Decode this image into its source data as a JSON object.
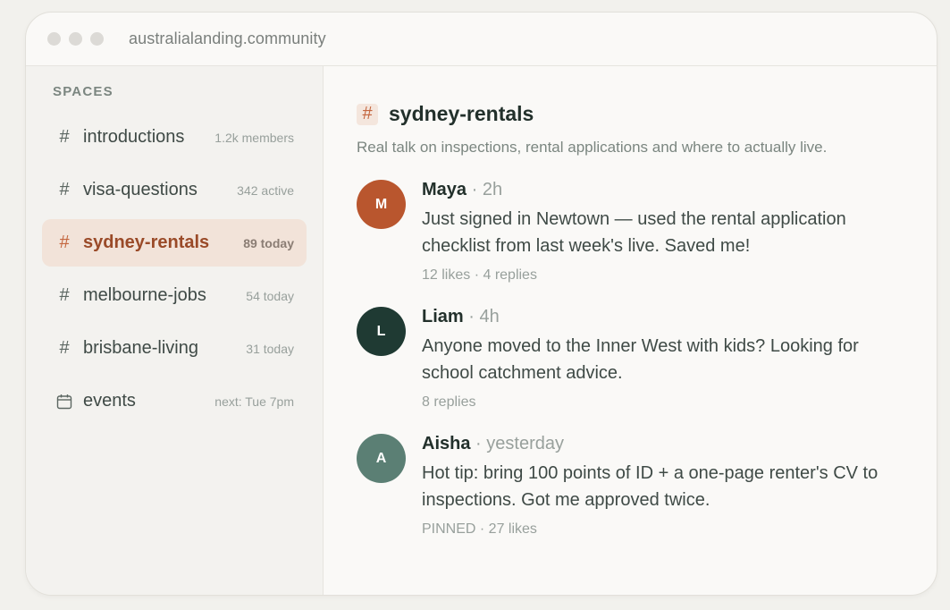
{
  "browser": {
    "url": "australialanding.community"
  },
  "sidebar": {
    "section_label": "SPACES",
    "items": [
      {
        "name": "introductions",
        "meta": "1.2k members",
        "icon": "hash-icon",
        "active": false
      },
      {
        "name": "visa-questions",
        "meta": "342 active",
        "icon": "hash-icon",
        "active": false
      },
      {
        "name": "sydney-rentals",
        "meta": "89 today",
        "icon": "hash-icon",
        "active": true
      },
      {
        "name": "melbourne-jobs",
        "meta": "54 today",
        "icon": "hash-icon",
        "active": false
      },
      {
        "name": "brisbane-living",
        "meta": "31 today",
        "icon": "hash-icon",
        "active": false
      },
      {
        "name": "events",
        "meta": "next: Tue 7pm",
        "icon": "calendar-icon",
        "active": false
      }
    ]
  },
  "channel": {
    "title": "sydney-rentals",
    "description": "Real talk on inspections, rental applications and where to actually live."
  },
  "posts": [
    {
      "initial": "M",
      "author": "Maya",
      "time": "2h",
      "text": "Just signed in Newtown — used the rental application checklist from last week's live. Saved me!",
      "stats": "12 likes · 4 replies",
      "avatar_color": "#b9562e"
    },
    {
      "initial": "L",
      "author": "Liam",
      "time": "4h",
      "text": "Anyone moved to the Inner West with kids? Looking for school catchment advice.",
      "stats": "8 replies",
      "avatar_color": "#1f3a33"
    },
    {
      "initial": "A",
      "author": "Aisha",
      "time": "yesterday",
      "text": "Hot tip: bring 100 points of ID + a one-page renter's CV to inspections. Got me approved twice.",
      "stats": "PINNED · 27 likes",
      "avatar_color": "#5b7f74"
    }
  ],
  "colors": {
    "accent": "#c4663f",
    "active_bg": "#f2e3d9"
  }
}
